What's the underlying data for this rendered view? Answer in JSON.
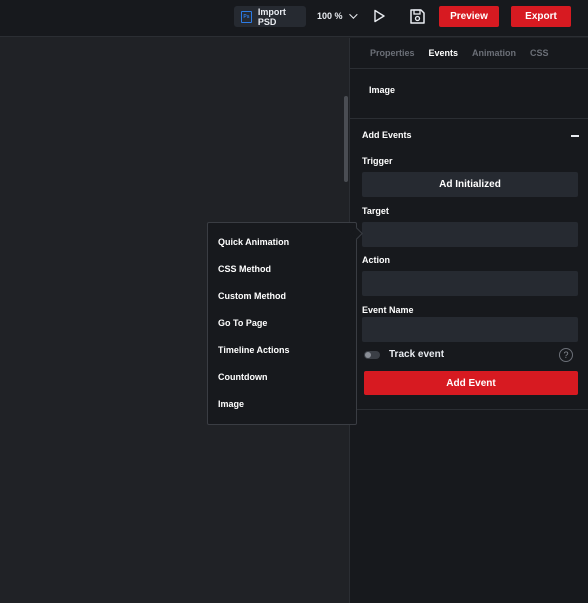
{
  "toolbar": {
    "import_label": "Import PSD",
    "import_icon": "psd-file-icon",
    "zoom_label": "100 %",
    "play_icon": "play-icon",
    "save_icon": "save-icon",
    "preview_label": "Preview",
    "export_label": "Export",
    "accent_color": "#d71a21"
  },
  "panel": {
    "tabs": [
      {
        "label": "Properties",
        "active": false
      },
      {
        "label": "Events",
        "active": true
      },
      {
        "label": "Animation",
        "active": false
      },
      {
        "label": "CSS",
        "active": false
      }
    ],
    "selected_element": "Image",
    "section_title": "Add Events",
    "fields": {
      "trigger": {
        "label": "Trigger",
        "value": "Ad Initialized"
      },
      "target": {
        "label": "Target",
        "value": ""
      },
      "action": {
        "label": "Action",
        "value": ""
      },
      "event_name": {
        "label": "Event Name",
        "value": ""
      }
    },
    "track_event_label": "Track event",
    "help_symbol": "?",
    "add_event_label": "Add Event"
  },
  "menu": {
    "items": [
      "Quick Animation",
      "CSS Method",
      "Custom Method",
      "Go To Page",
      "Timeline Actions",
      "Countdown",
      "Image"
    ]
  }
}
